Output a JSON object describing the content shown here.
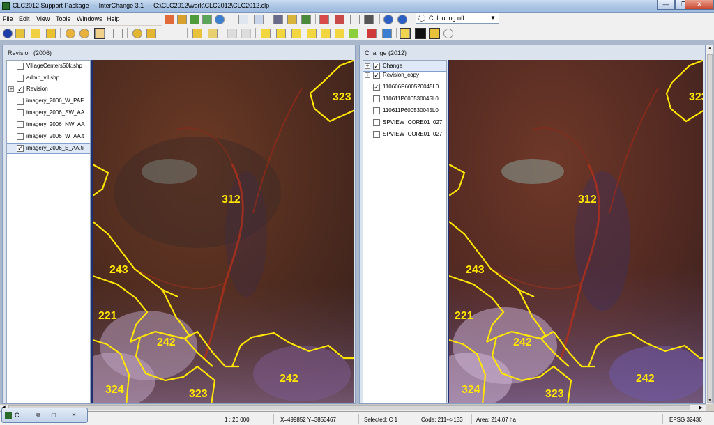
{
  "window": {
    "title": "CLC2012 Support Package --- InterChange 3.1 --- C:\\CLC2012\\work\\CLC2012\\CLC2012.clp",
    "minimize": "—",
    "restore": "❐",
    "close": "✕"
  },
  "menu": [
    "File",
    "Edit",
    "View",
    "Tools",
    "Windows",
    "Help"
  ],
  "colour_select": {
    "value": "Colouring off",
    "arrow": "▼"
  },
  "panels": {
    "left": {
      "title": "Revision (2006)",
      "layers": [
        {
          "label": "VillageCenters50k.shp",
          "checked": "",
          "expander": ""
        },
        {
          "label": "admb_vil.shp",
          "checked": "",
          "expander": ""
        },
        {
          "label": "Revision",
          "checked": "✓",
          "expander": "+"
        },
        {
          "label": "imagery_2006_W_PAF",
          "checked": "",
          "expander": ""
        },
        {
          "label": "imagery_2006_SW_AA",
          "checked": "",
          "expander": ""
        },
        {
          "label": "imagery_2006_NW_AA",
          "checked": "",
          "expander": ""
        },
        {
          "label": "imagery_2006_W_AA.t",
          "checked": "",
          "expander": ""
        },
        {
          "label": "imagery_2006_E_AA.ti",
          "checked": "✓",
          "expander": ""
        }
      ]
    },
    "right": {
      "title": "Change (2012)",
      "layers": [
        {
          "label": "Change",
          "checked": "✓",
          "expander": "+"
        },
        {
          "label": "Revision_copy",
          "checked": "✓",
          "expander": "+"
        },
        {
          "label": "110606P600520045L0",
          "checked": "✓",
          "expander": ""
        },
        {
          "label": "110611P600530045L0",
          "checked": "",
          "expander": ""
        },
        {
          "label": "110611P600530045L0",
          "checked": "",
          "expander": ""
        },
        {
          "label": "SPVIEW_CORE01_027",
          "checked": "",
          "expander": ""
        },
        {
          "label": "SPVIEW_CORE01_027",
          "checked": "",
          "expander": ""
        }
      ]
    }
  },
  "map_labels": [
    "323",
    "312",
    "243",
    "221",
    "242",
    "324",
    "323",
    "242"
  ],
  "statusbar": {
    "scale": "1 : 20 000",
    "coords": "X=499852  Y=3853467",
    "selected": "Selected: C 1",
    "code": "Code: 211-->133",
    "area": "Area: 214,07 ha",
    "epsg": "EPSG 32436"
  },
  "minimized_window": {
    "title": "C...",
    "b1": "⧉",
    "b2": "▢",
    "b3": "✕"
  },
  "colors": {
    "polygon": "#ffe600",
    "label": "#ffe600"
  }
}
